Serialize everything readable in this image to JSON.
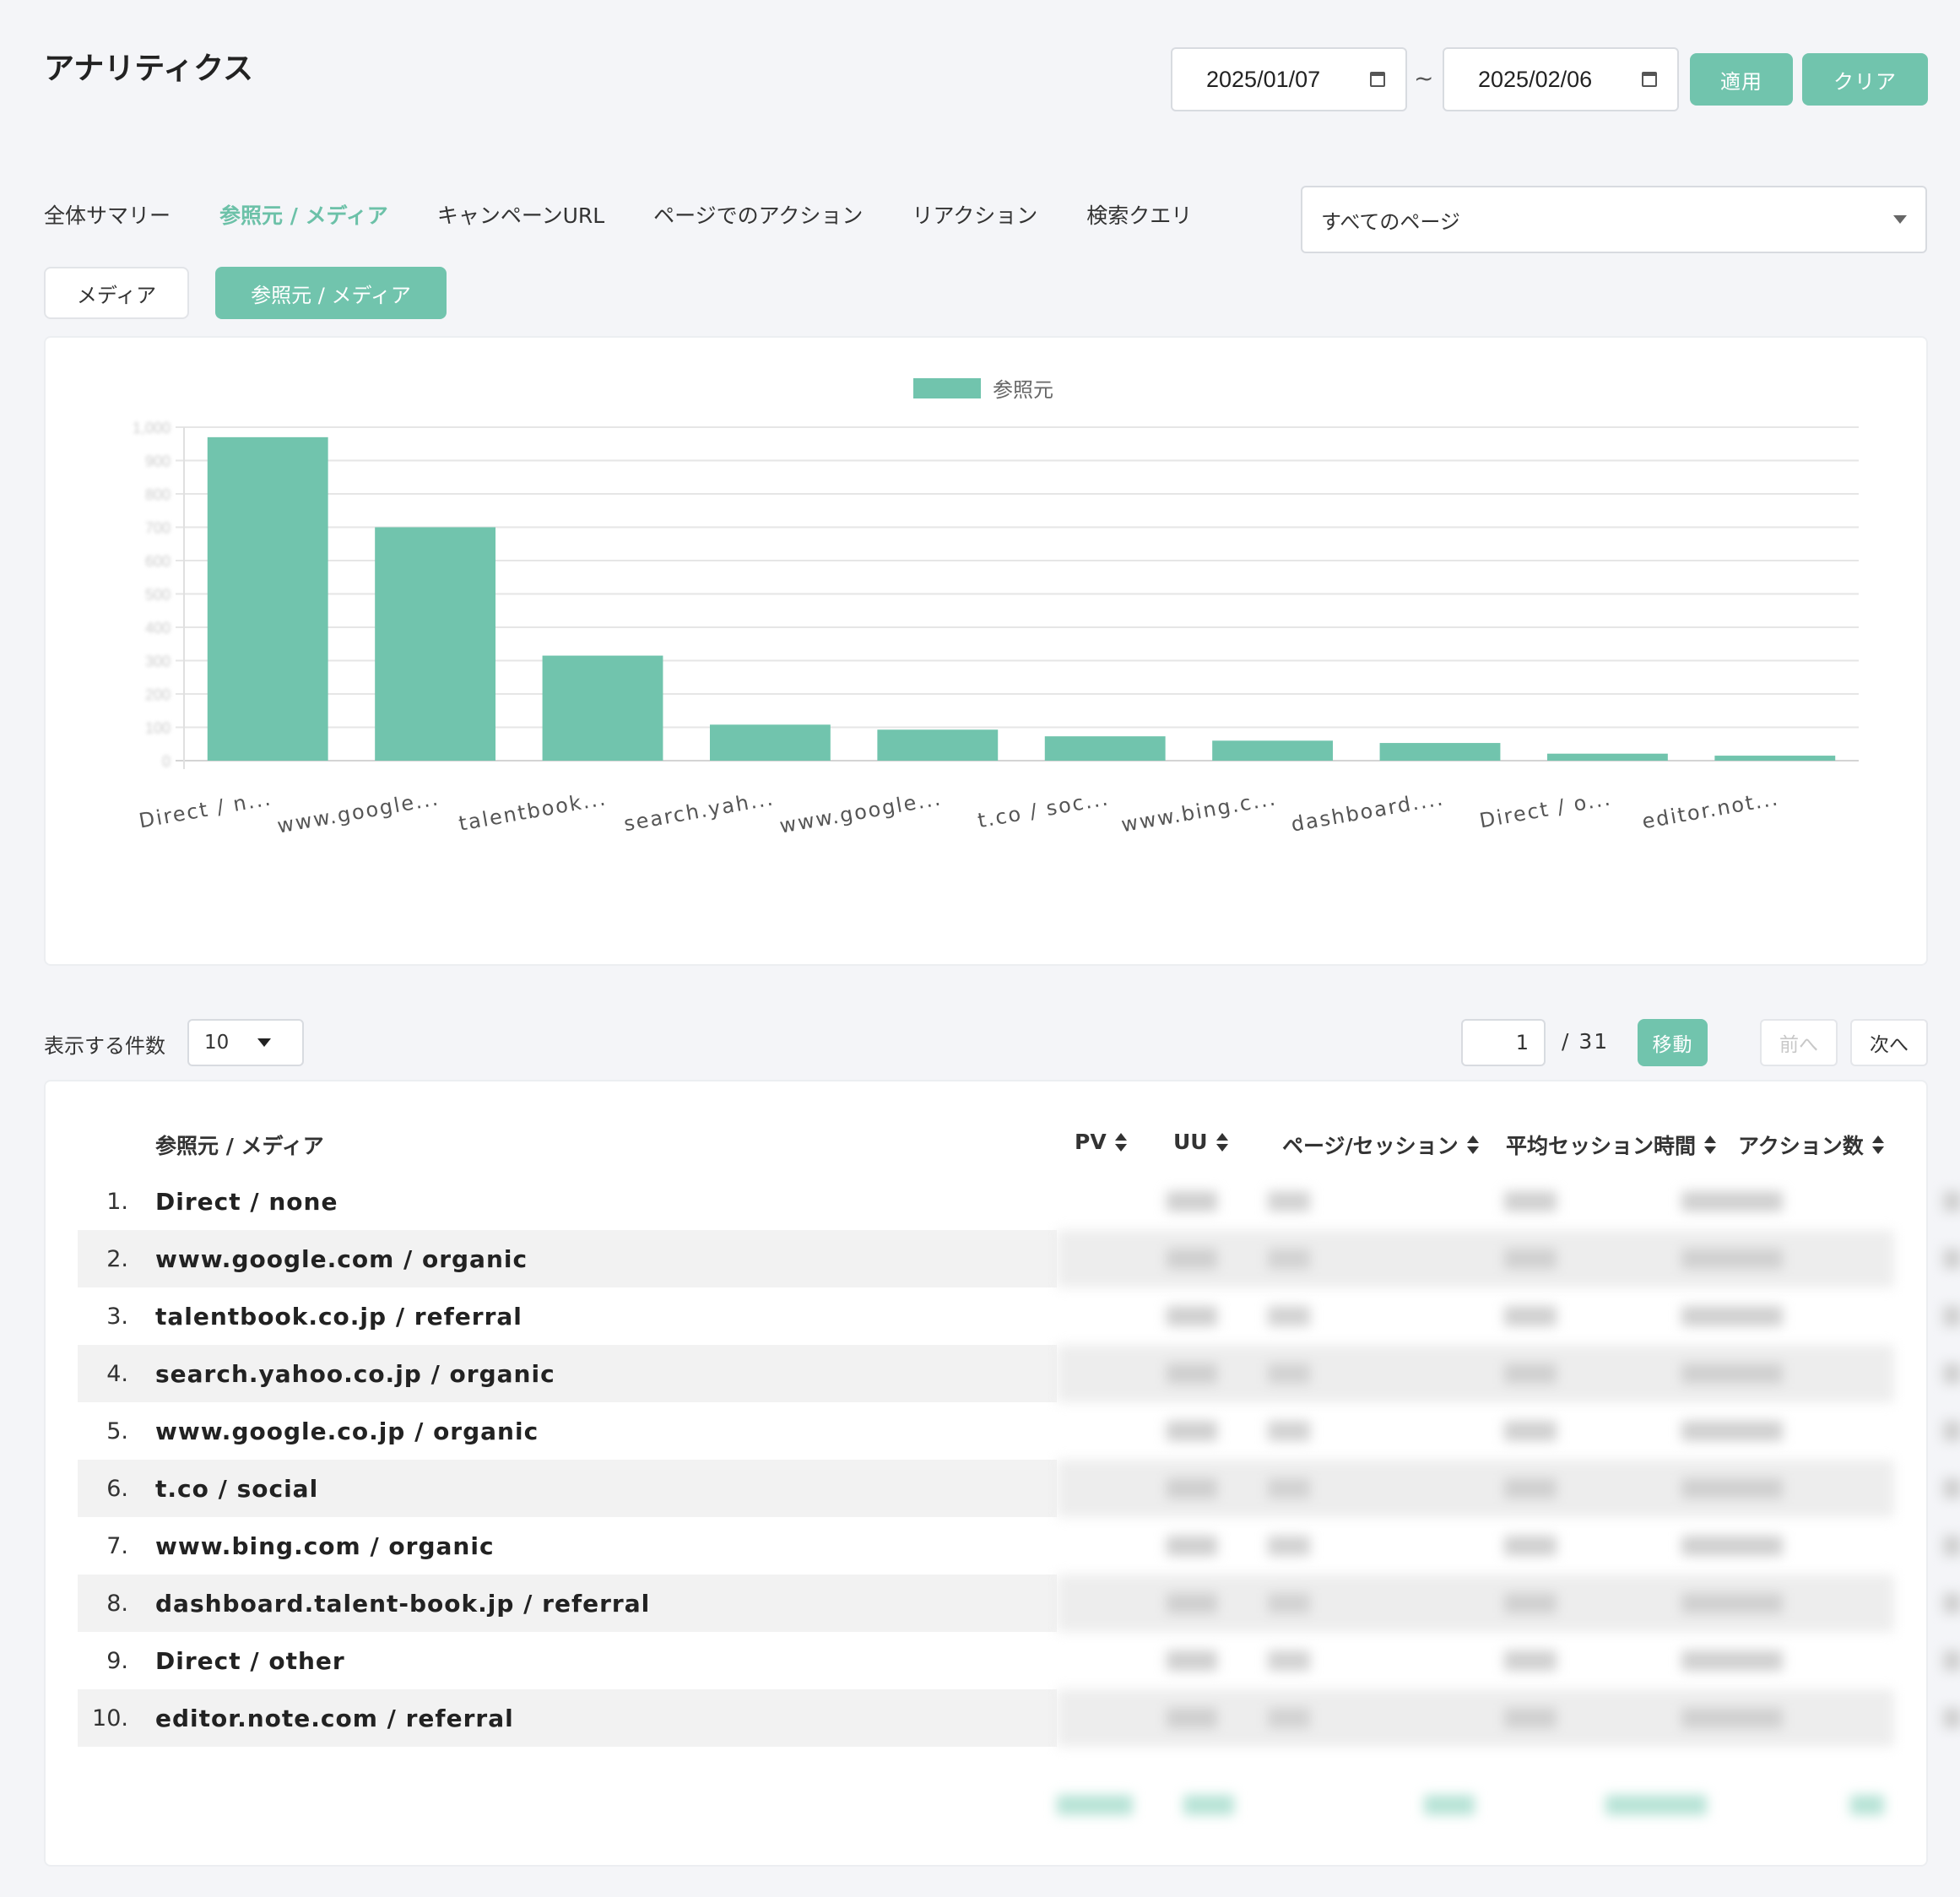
{
  "header": {
    "title": "アナリティクス",
    "date_from": "2025/01/07",
    "date_to": "2025/02/06",
    "tilde": "~",
    "apply_label": "適用",
    "clear_label": "クリア"
  },
  "tabs": [
    {
      "label": "全体サマリー",
      "active": false
    },
    {
      "label": "参照元 / メディア",
      "active": true
    },
    {
      "label": "キャンペーンURL",
      "active": false
    },
    {
      "label": "ページでのアクション",
      "active": false
    },
    {
      "label": "リアクション",
      "active": false
    },
    {
      "label": "検索クエリ",
      "active": false
    }
  ],
  "page_filter": {
    "selected": "すべてのページ"
  },
  "subtabs": {
    "media": "メディア",
    "source_media": "参照元 / メディア",
    "active": "source_media"
  },
  "colors": {
    "accent": "#71c4ad",
    "active_tab": "#6cc1a8",
    "background": "#f4f5f8"
  },
  "chart_data": {
    "type": "bar",
    "legend": "参照元",
    "legend_position": "top-center",
    "grid": true,
    "categories": [
      "Direct / n...",
      "www.google...",
      "talentbook...",
      "search.yah...",
      "www.google...",
      "t.co / soc...",
      "www.bing.c...",
      "dashboard....",
      "Direct / o...",
      "editor.not..."
    ],
    "values": [
      970,
      700,
      315,
      108,
      93,
      73,
      60,
      53,
      21,
      15
    ],
    "ylim": [
      0,
      1000
    ],
    "yticks": [
      "0",
      "100",
      "200",
      "300",
      "400",
      "500",
      "600",
      "700",
      "800",
      "900",
      "1,000"
    ]
  },
  "pagination": {
    "per_page_label": "表示する件数",
    "per_page": "10",
    "current_page": "1",
    "total_pages": "/  31",
    "go_label": "移動",
    "prev_label": "前へ",
    "next_label": "次へ"
  },
  "table": {
    "headers": {
      "source": "参照元 / メディア",
      "pv": "PV",
      "uu": "UU",
      "pages_per_session": "ページ/セッション",
      "avg_session": "平均セッション時間",
      "actions": "アクション数"
    },
    "rows": [
      {
        "rank": "1.",
        "label": "Direct / none"
      },
      {
        "rank": "2.",
        "label": "www.google.com / organic"
      },
      {
        "rank": "3.",
        "label": "talentbook.co.jp / referral"
      },
      {
        "rank": "4.",
        "label": "search.yahoo.co.jp / organic"
      },
      {
        "rank": "5.",
        "label": "www.google.co.jp / organic"
      },
      {
        "rank": "6.",
        "label": "t.co / social"
      },
      {
        "rank": "7.",
        "label": "www.bing.com / organic"
      },
      {
        "rank": "8.",
        "label": "dashboard.talent-book.jp / referral"
      },
      {
        "rank": "9.",
        "label": "Direct / other"
      },
      {
        "rank": "10.",
        "label": "editor.note.com / referral"
      }
    ]
  }
}
